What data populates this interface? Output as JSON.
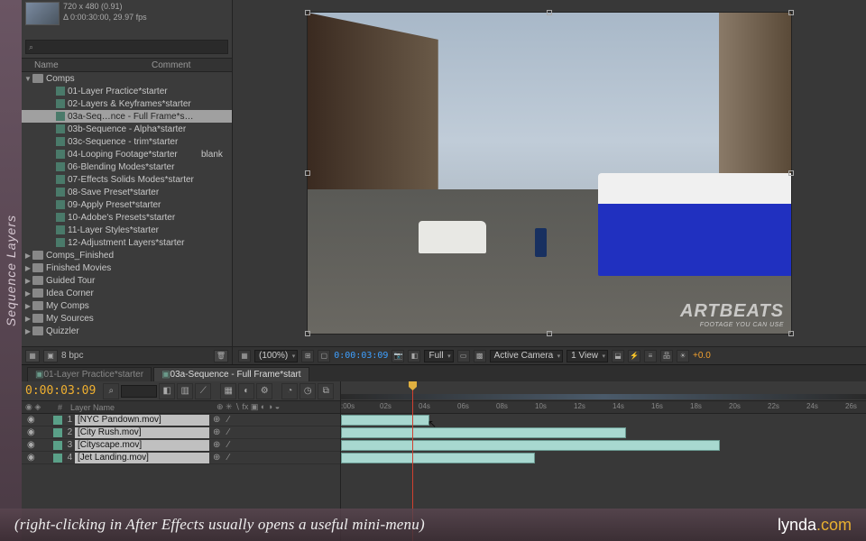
{
  "sideLabel": "Sequence Layers",
  "project": {
    "meta": {
      "dims": "720 x 480 (0.91)",
      "dur": "Δ 0:00:30:00, 29.97 fps"
    },
    "search": {
      "icon": "⌕"
    },
    "columns": {
      "name": "Name",
      "comment": "Comment"
    },
    "tree": [
      {
        "label": "Comps",
        "indent": 0,
        "kind": "folder",
        "exp": true
      },
      {
        "label": "01-Layer Practice*starter",
        "indent": 2,
        "kind": "comp"
      },
      {
        "label": "02-Layers & Keyframes*starter",
        "indent": 2,
        "kind": "comp"
      },
      {
        "label": "03a-Seq…nce - Full Frame*start",
        "indent": 2,
        "kind": "comp",
        "sel": true
      },
      {
        "label": "03b-Sequence - Alpha*starter",
        "indent": 2,
        "kind": "comp"
      },
      {
        "label": "03c-Sequence - trim*starter",
        "indent": 2,
        "kind": "comp"
      },
      {
        "label": "04-Looping Footage*starter",
        "indent": 2,
        "kind": "comp",
        "comment": "blank"
      },
      {
        "label": "06-Blending Modes*starter",
        "indent": 2,
        "kind": "comp"
      },
      {
        "label": "07-Effects Solids Modes*starter",
        "indent": 2,
        "kind": "comp"
      },
      {
        "label": "08-Save Preset*starter",
        "indent": 2,
        "kind": "comp"
      },
      {
        "label": "09-Apply Preset*starter",
        "indent": 2,
        "kind": "comp"
      },
      {
        "label": "10-Adobe's Presets*starter",
        "indent": 2,
        "kind": "comp"
      },
      {
        "label": "11-Layer Styles*starter",
        "indent": 2,
        "kind": "comp"
      },
      {
        "label": "12-Adjustment Layers*starter",
        "indent": 2,
        "kind": "comp"
      },
      {
        "label": "Comps_Finished",
        "indent": 0,
        "kind": "folder"
      },
      {
        "label": "Finished Movies",
        "indent": 0,
        "kind": "folder"
      },
      {
        "label": "Guided Tour",
        "indent": 0,
        "kind": "folder"
      },
      {
        "label": "Idea Corner",
        "indent": 0,
        "kind": "folder"
      },
      {
        "label": "My Comps",
        "indent": 0,
        "kind": "folder"
      },
      {
        "label": "My Sources",
        "indent": 0,
        "kind": "folder"
      },
      {
        "label": "Quizzler",
        "indent": 0,
        "kind": "folder"
      }
    ],
    "footer": {
      "bpc": "8 bpc"
    }
  },
  "viewer": {
    "watermark": {
      "big": "ARTBEATS",
      "small": "FOOTAGE YOU CAN USE"
    },
    "footer": {
      "zoom": "(100%)",
      "timecode": "0:00:03:09",
      "res": "Full",
      "camera": "Active Camera",
      "views": "1 View",
      "exposure": "+0.0"
    }
  },
  "timeline": {
    "tabs": [
      {
        "label": "01-Layer Practice*starter",
        "active": false
      },
      {
        "label": "03a-Sequence - Full Frame*start",
        "active": true
      }
    ],
    "currentTime": "0:00:03:09",
    "columns": {
      "num": "#",
      "layerName": "Layer Name"
    },
    "ruler": [
      ":00s",
      "02s",
      "04s",
      "06s",
      "08s",
      "10s",
      "12s",
      "14s",
      "16s",
      "18s",
      "20s",
      "22s",
      "24s",
      "26s"
    ],
    "layers": [
      {
        "num": "1",
        "name": "[NYC Pandown.mov]",
        "start": 0,
        "end": 98
      },
      {
        "num": "2",
        "name": "[City Rush.mov]",
        "start": 0,
        "end": 316
      },
      {
        "num": "3",
        "name": "[Cityscape.mov]",
        "start": 0,
        "end": 420
      },
      {
        "num": "4",
        "name": "[Jet Landing.mov]",
        "start": 0,
        "end": 215
      }
    ],
    "playheadPx": 79
  },
  "caption": {
    "text": "(right-clicking in After Effects usually opens a useful mini-menu)",
    "brand": "lynda",
    "domain": ".com"
  }
}
